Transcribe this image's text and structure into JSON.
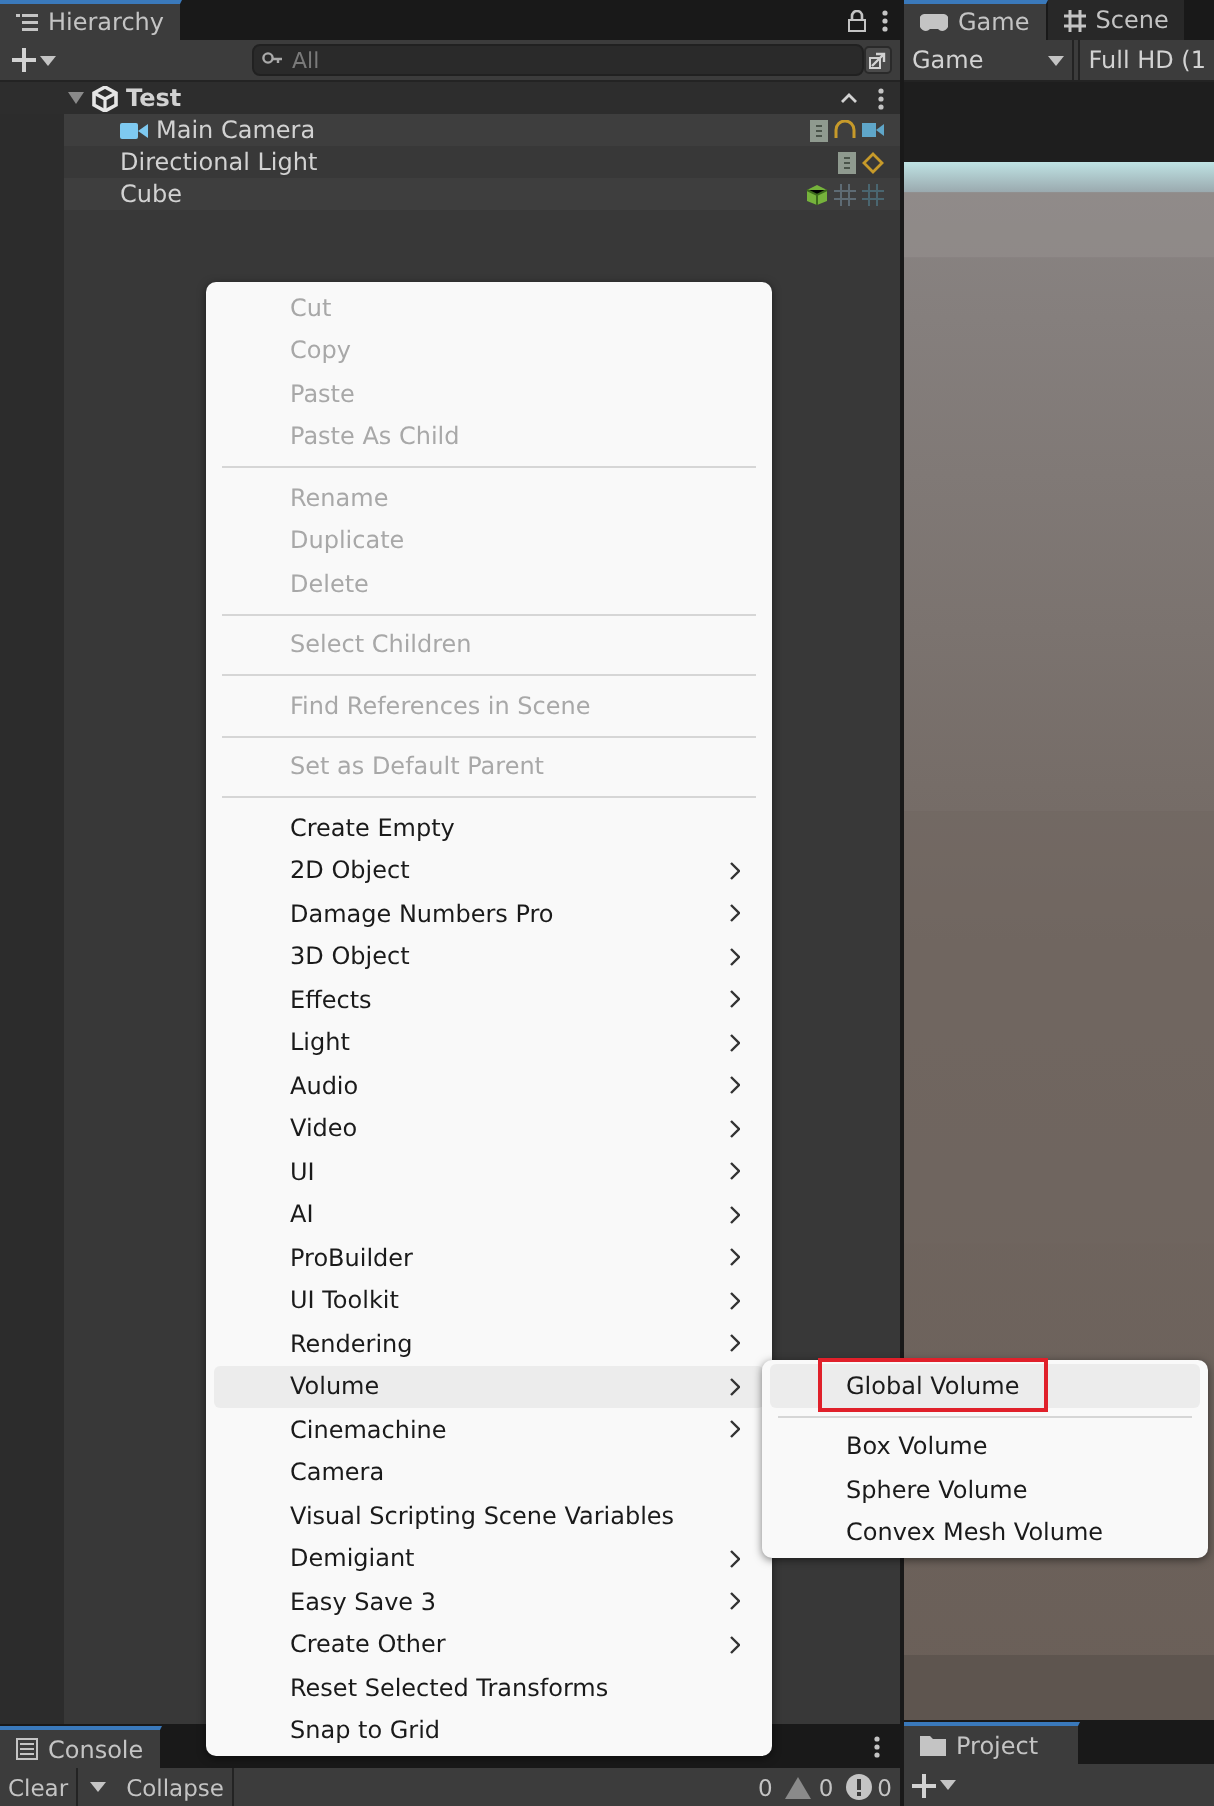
{
  "hierarchy": {
    "tab": "Hierarchy",
    "search": {
      "placeholder": "All"
    },
    "tree": [
      {
        "label": "Test",
        "kind": "scene",
        "expanded": true,
        "children": [
          {
            "label": "Main Camera",
            "kind": "camera"
          },
          {
            "label": "Directional Light",
            "kind": "light"
          },
          {
            "label": "Cube",
            "kind": "cube"
          }
        ]
      }
    ]
  },
  "game": {
    "tabs": [
      {
        "label": "Game",
        "kind": "game",
        "selected": true
      },
      {
        "label": "Scene",
        "kind": "scene",
        "selected": false
      }
    ],
    "display": "Game",
    "resolution": "Full HD (1"
  },
  "console": {
    "tab": "Console",
    "buttons": [
      {
        "label": "Clear"
      },
      {
        "label": "Collapse"
      }
    ],
    "counts": [
      {
        "kind": "info",
        "value": "0"
      },
      {
        "kind": "warning",
        "value": "0"
      },
      {
        "kind": "error",
        "value": "0"
      }
    ]
  },
  "project": {
    "tab": "Project"
  },
  "context_menu": {
    "items": [
      {
        "kind": "item",
        "label": "Cut",
        "disabled": true,
        "submenu": false,
        "selected": false
      },
      {
        "kind": "item",
        "label": "Copy",
        "disabled": true,
        "submenu": false,
        "selected": false
      },
      {
        "kind": "item",
        "label": "Paste",
        "disabled": true,
        "submenu": false,
        "selected": false
      },
      {
        "kind": "item",
        "label": "Paste As Child",
        "disabled": true,
        "submenu": false,
        "selected": false
      },
      {
        "kind": "separator"
      },
      {
        "kind": "item",
        "label": "Rename",
        "disabled": true,
        "submenu": false,
        "selected": false
      },
      {
        "kind": "item",
        "label": "Duplicate",
        "disabled": true,
        "submenu": false,
        "selected": false
      },
      {
        "kind": "item",
        "label": "Delete",
        "disabled": true,
        "submenu": false,
        "selected": false
      },
      {
        "kind": "separator"
      },
      {
        "kind": "item",
        "label": "Select Children",
        "disabled": true,
        "submenu": false,
        "selected": false
      },
      {
        "kind": "separator"
      },
      {
        "kind": "item",
        "label": "Find References in Scene",
        "disabled": true,
        "submenu": false,
        "selected": false
      },
      {
        "kind": "separator"
      },
      {
        "kind": "item",
        "label": "Set as Default Parent",
        "disabled": true,
        "submenu": false,
        "selected": false
      },
      {
        "kind": "separator"
      },
      {
        "kind": "item",
        "label": "Create Empty",
        "disabled": false,
        "submenu": false,
        "selected": false
      },
      {
        "kind": "item",
        "label": "2D Object",
        "disabled": false,
        "submenu": true,
        "selected": false
      },
      {
        "kind": "item",
        "label": "Damage Numbers Pro",
        "disabled": false,
        "submenu": true,
        "selected": false
      },
      {
        "kind": "item",
        "label": "3D Object",
        "disabled": false,
        "submenu": true,
        "selected": false
      },
      {
        "kind": "item",
        "label": "Effects",
        "disabled": false,
        "submenu": true,
        "selected": false
      },
      {
        "kind": "item",
        "label": "Light",
        "disabled": false,
        "submenu": true,
        "selected": false
      },
      {
        "kind": "item",
        "label": "Audio",
        "disabled": false,
        "submenu": true,
        "selected": false
      },
      {
        "kind": "item",
        "label": "Video",
        "disabled": false,
        "submenu": true,
        "selected": false
      },
      {
        "kind": "item",
        "label": "UI",
        "disabled": false,
        "submenu": true,
        "selected": false
      },
      {
        "kind": "item",
        "label": "AI",
        "disabled": false,
        "submenu": true,
        "selected": false
      },
      {
        "kind": "item",
        "label": "ProBuilder",
        "disabled": false,
        "submenu": true,
        "selected": false
      },
      {
        "kind": "item",
        "label": "UI Toolkit",
        "disabled": false,
        "submenu": true,
        "selected": false
      },
      {
        "kind": "item",
        "label": "Rendering",
        "disabled": false,
        "submenu": true,
        "selected": false
      },
      {
        "kind": "item",
        "label": "Volume",
        "disabled": false,
        "submenu": true,
        "selected": true
      },
      {
        "kind": "item",
        "label": "Cinemachine",
        "disabled": false,
        "submenu": true,
        "selected": false
      },
      {
        "kind": "item",
        "label": "Camera",
        "disabled": false,
        "submenu": false,
        "selected": false
      },
      {
        "kind": "item",
        "label": "Visual Scripting Scene Variables",
        "disabled": false,
        "submenu": false,
        "selected": false
      },
      {
        "kind": "item",
        "label": "Demigiant",
        "disabled": false,
        "submenu": true,
        "selected": false
      },
      {
        "kind": "item",
        "label": "Easy Save 3",
        "disabled": false,
        "submenu": true,
        "selected": false
      },
      {
        "kind": "item",
        "label": "Create Other",
        "disabled": false,
        "submenu": true,
        "selected": false
      },
      {
        "kind": "item",
        "label": "Reset Selected Transforms",
        "disabled": false,
        "submenu": false,
        "selected": false
      },
      {
        "kind": "item",
        "label": "Snap to Grid",
        "disabled": false,
        "submenu": false,
        "selected": false
      }
    ]
  },
  "submenu": {
    "items": [
      {
        "kind": "item",
        "label": "Global Volume",
        "disabled": false,
        "submenu": false,
        "selected": true,
        "annotated": true
      },
      {
        "kind": "separator"
      },
      {
        "kind": "item",
        "label": "Box Volume",
        "disabled": false,
        "submenu": false,
        "selected": false,
        "annotated": false
      },
      {
        "kind": "item",
        "label": "Sphere Volume",
        "disabled": false,
        "submenu": false,
        "selected": false,
        "annotated": false
      },
      {
        "kind": "item",
        "label": "Convex Mesh Volume",
        "disabled": false,
        "submenu": false,
        "selected": false,
        "annotated": false
      }
    ]
  }
}
